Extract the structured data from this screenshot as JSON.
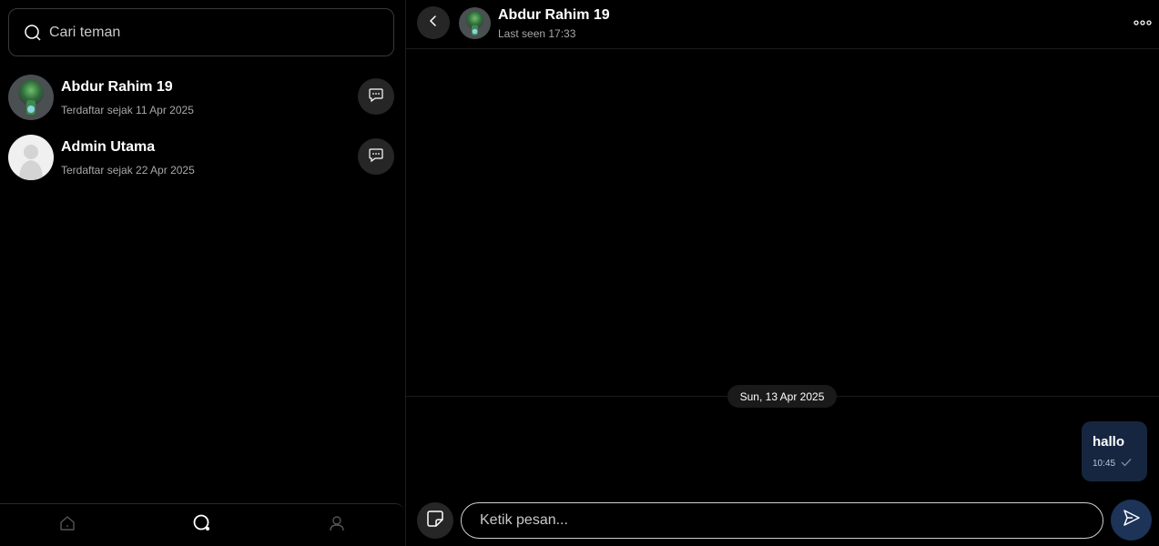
{
  "search": {
    "placeholder": "Cari teman"
  },
  "contacts": [
    {
      "name": "Abdur Rahim 19",
      "subtitle": "Terdaftar sejak 11 Apr 2025"
    },
    {
      "name": "Admin Utama",
      "subtitle": "Terdaftar sejak 22 Apr 2025"
    }
  ],
  "bottom_nav": [
    {
      "icon": "home-icon"
    },
    {
      "icon": "chat-search-icon"
    },
    {
      "icon": "profile-icon"
    }
  ],
  "chat": {
    "contact_name": "Abdur Rahim 19",
    "last_seen": "Last seen 17:33",
    "date_divider": "Sun, 13 Apr 2025",
    "messages": [
      {
        "text": "hallo",
        "time": "10:45",
        "status": "sent-check"
      }
    ],
    "composer_placeholder": "Ketik pesan..."
  },
  "colors": {
    "background": "#000000",
    "bubble": "#172640",
    "send_button": "#1d3357",
    "icon_button": "#262626"
  }
}
